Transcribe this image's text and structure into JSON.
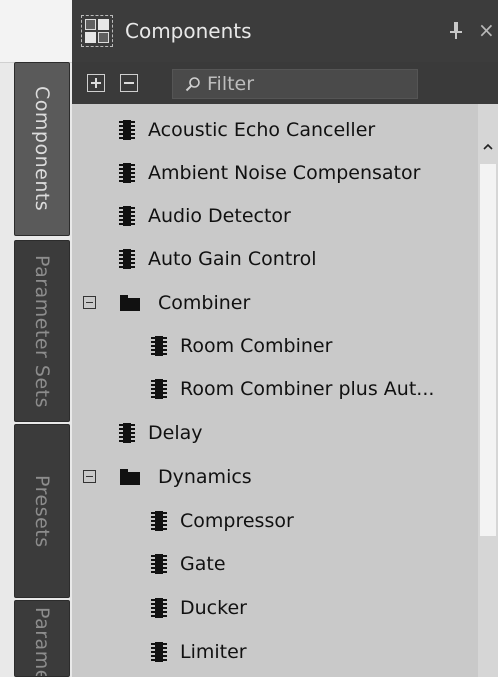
{
  "side_tabs": [
    {
      "label": "Components",
      "active": true
    },
    {
      "label": "Parameter Sets",
      "active": false
    },
    {
      "label": "Presets",
      "active": false
    },
    {
      "label": "Parame",
      "active": false
    }
  ],
  "panel": {
    "title": "Components",
    "pin_icon": "pin-icon",
    "close_glyph": "×"
  },
  "toolbar": {
    "expand_icon": "expand-all-icon",
    "collapse_icon": "collapse-all-icon",
    "filter_placeholder": "Filter"
  },
  "tree": [
    {
      "label": "Acoustic Echo Canceller",
      "type": "component",
      "level": 0
    },
    {
      "label": "Ambient Noise Compensator",
      "type": "component",
      "level": 0
    },
    {
      "label": "Audio Detector",
      "type": "component",
      "level": 0
    },
    {
      "label": "Auto Gain Control",
      "type": "component",
      "level": 0
    },
    {
      "label": "Combiner",
      "type": "folder",
      "level": 0,
      "expanded": true
    },
    {
      "label": "Room Combiner",
      "type": "component",
      "level": 1
    },
    {
      "label": "Room Combiner plus Aut...",
      "type": "component",
      "level": 1
    },
    {
      "label": "Delay",
      "type": "component",
      "level": 0
    },
    {
      "label": "Dynamics",
      "type": "folder",
      "level": 0,
      "expanded": true
    },
    {
      "label": "Compressor",
      "type": "component",
      "level": 1
    },
    {
      "label": "Gate",
      "type": "component",
      "level": 1
    },
    {
      "label": "Ducker",
      "type": "component",
      "level": 1
    },
    {
      "label": "Limiter",
      "type": "component",
      "level": 1
    }
  ],
  "colors": {
    "titlebar": "#3c3c3c",
    "list_bg": "#c9c9c9",
    "active_tab": "#5a5a5a",
    "inactive_tab": "#3b3b3b"
  }
}
